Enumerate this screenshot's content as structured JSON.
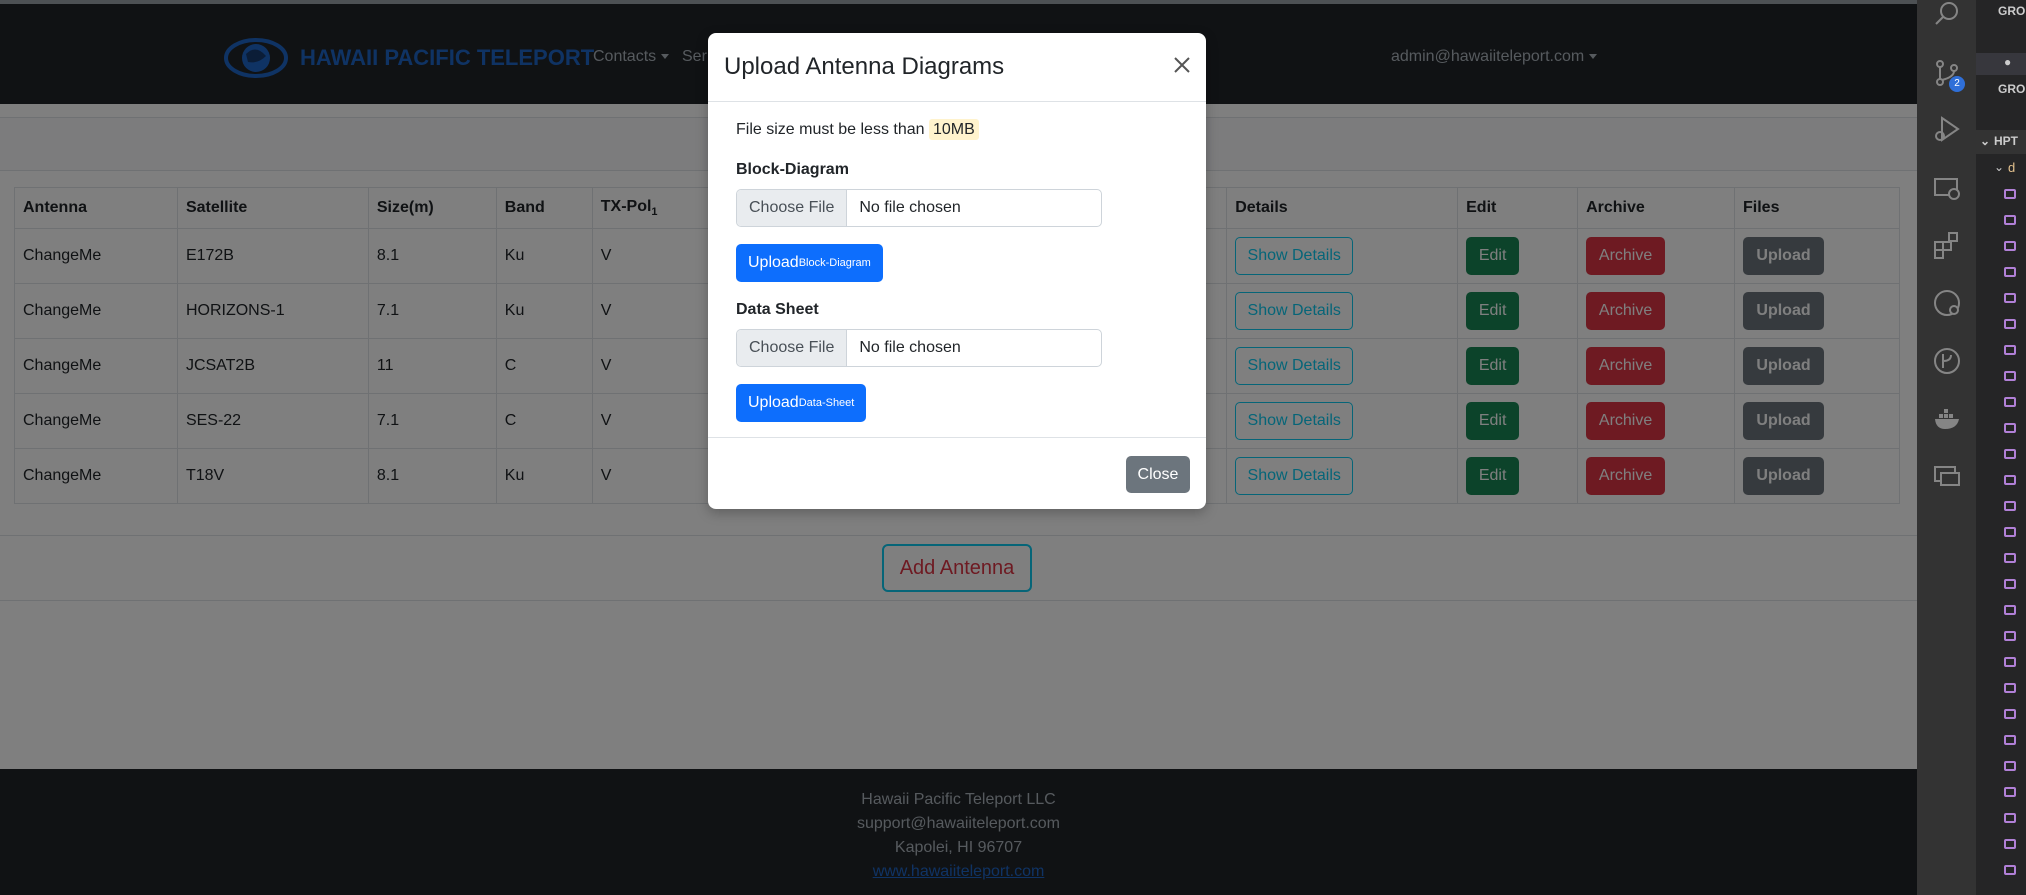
{
  "navbar": {
    "brand": "HAWAII PACIFIC TELEPORT",
    "links": [
      {
        "label": "Contacts"
      },
      {
        "label": "Ser"
      }
    ],
    "user": "admin@hawaiiteleport.com"
  },
  "table": {
    "headers": {
      "antenna": "Antenna",
      "satellite": "Satellite",
      "size": "Size(m)",
      "band": "Band",
      "txpol": "TX-Pol",
      "txpol_sub": "1",
      "details": "Details",
      "edit": "Edit",
      "archive": "Archive",
      "files": "Files"
    },
    "rows": [
      {
        "antenna": "ChangeMe",
        "satellite": "E172B",
        "size": "8.1",
        "band": "Ku",
        "txpol": "V"
      },
      {
        "antenna": "ChangeMe",
        "satellite": "HORIZONS-1",
        "size": "7.1",
        "band": "Ku",
        "txpol": "V"
      },
      {
        "antenna": "ChangeMe",
        "satellite": "JCSAT2B",
        "size": "11",
        "band": "C",
        "txpol": "V"
      },
      {
        "antenna": "ChangeMe",
        "satellite": "SES-22",
        "size": "7.1",
        "band": "C",
        "txpol": "V"
      },
      {
        "antenna": "ChangeMe",
        "satellite": "T18V",
        "size": "8.1",
        "band": "Ku",
        "txpol": "V"
      }
    ],
    "buttons": {
      "details": "Show Details",
      "edit": "Edit",
      "archive": "Archive",
      "upload": "Upload"
    }
  },
  "add_antenna": "Add Antenna",
  "footer": {
    "company": "Hawaii Pacific Teleport LLC",
    "email": "support@hawaiiteleport.com",
    "address": "Kapolei, HI 96707",
    "website": "www.hawaiiteleport.com"
  },
  "modal": {
    "title": "Upload Antenna Diagrams",
    "note_prefix": "File size must be less than",
    "note_limit": "10MB",
    "block_label": "Block-Diagram",
    "choose_file": "Choose File",
    "no_file": "No file chosen",
    "upload_block": "Upload",
    "upload_block_sub": "Block-Diagram",
    "sheet_label": "Data Sheet",
    "upload_sheet": "Upload",
    "upload_sheet_sub": "Data-Sheet",
    "close": "Close"
  },
  "vscode": {
    "scm_badge": "2",
    "panel_rows": [
      {
        "text": "GRO"
      },
      {
        "text": "●"
      },
      {
        "text": "GRO"
      },
      {
        "text": "HPT"
      },
      {
        "text": "d"
      }
    ]
  },
  "colors": {
    "navbar_bg": "#212529",
    "primary": "#0d6efd",
    "success": "#198754",
    "danger": "#dc3545",
    "secondary": "#6c757d",
    "info": "#0dcaf0"
  }
}
